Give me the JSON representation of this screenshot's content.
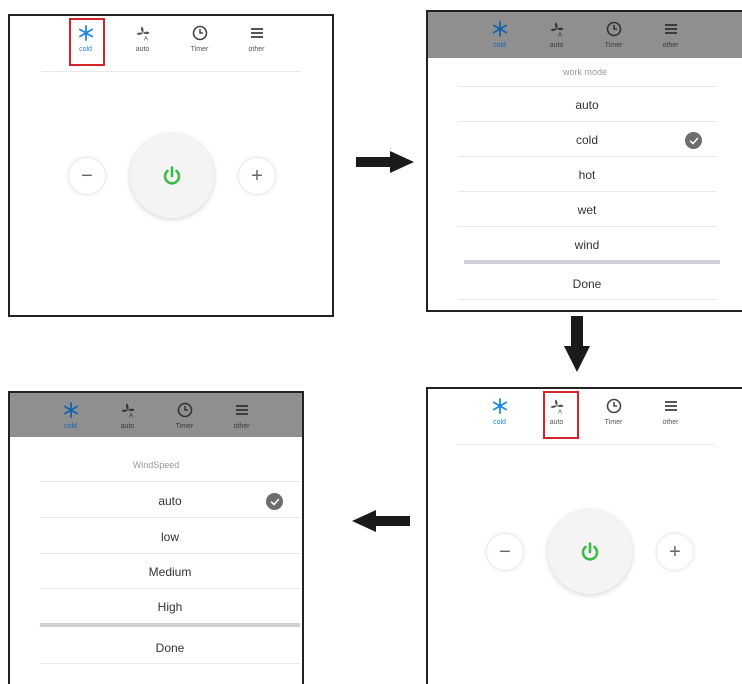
{
  "tabs": [
    {
      "label": "cold",
      "icon": "snowflake-icon"
    },
    {
      "label": "auto",
      "icon": "fan-auto-icon"
    },
    {
      "label": "Timer",
      "icon": "clock-icon"
    },
    {
      "label": "other",
      "icon": "menu-icon"
    }
  ],
  "colors": {
    "accent_blue": "#1e88e5",
    "power_green": "#3cba4a",
    "highlight_red": "#d3242a",
    "dim_overlay": "#8f8f8f"
  },
  "work_mode_sheet": {
    "title": "work mode",
    "options": [
      "auto",
      "cold",
      "hot",
      "wet",
      "wind"
    ],
    "selected": "cold",
    "done_label": "Done"
  },
  "wind_speed_sheet": {
    "title": "WindSpeed",
    "options": [
      "auto",
      "low",
      "Medium",
      "High"
    ],
    "selected": "auto",
    "done_label": "Done"
  },
  "controls": {
    "minus": "−",
    "plus": "+"
  },
  "flow": [
    "panel-1",
    "panel-2",
    "panel-3",
    "panel-4"
  ]
}
